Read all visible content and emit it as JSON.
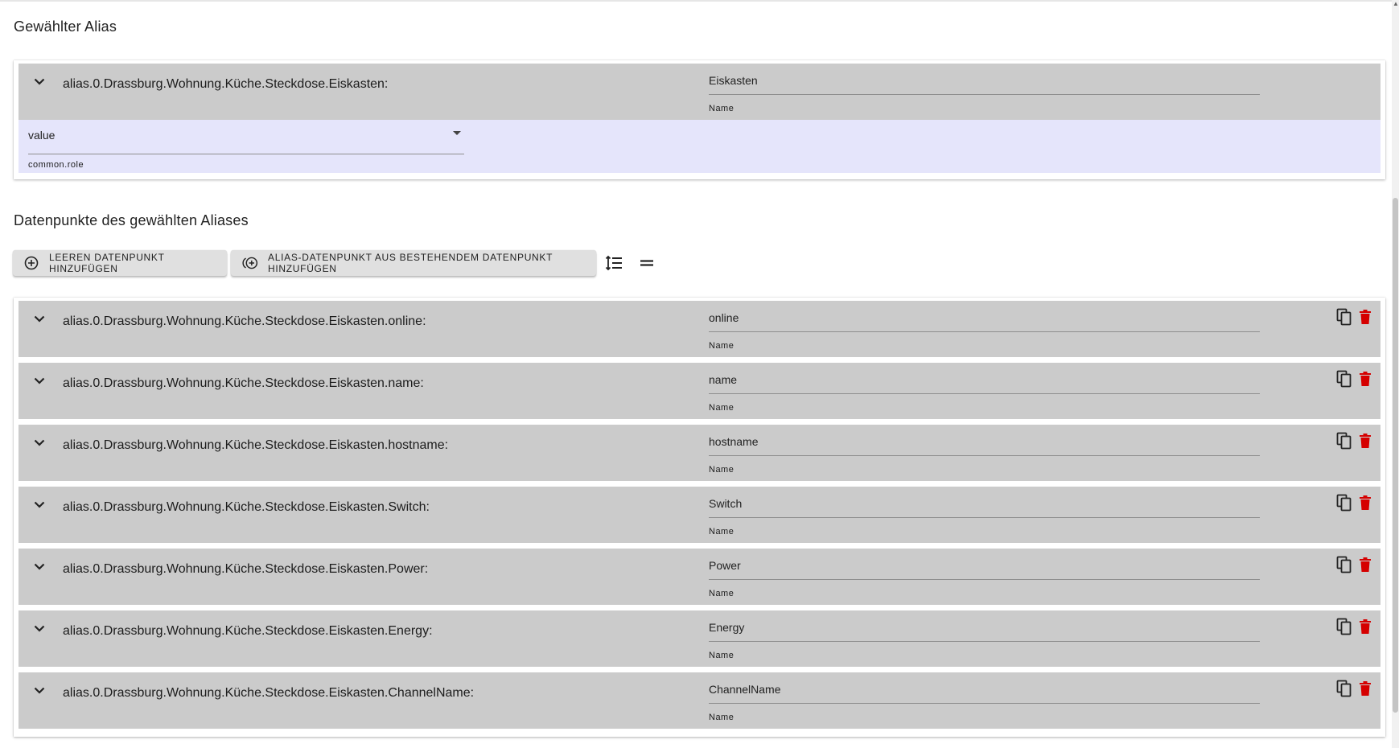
{
  "header": {
    "selected_alias_title": "Gewählter Alias",
    "datapoints_title": "Datenpunkte des gewählten Aliases"
  },
  "alias": {
    "id": "alias.0.Drassburg.Wohnung.Küche.Steckdose.Eiskasten:",
    "name_value": "Eiskasten",
    "name_label": "Name",
    "role_value": "value",
    "role_label": "common.role"
  },
  "toolbar": {
    "add_empty_label": "LEEREN DATENPUNKT HINZUFÜGEN",
    "add_from_existing_label": "ALIAS-DATENPUNKT AUS BESTEHENDEM DATENPUNKT HINZUFÜGEN"
  },
  "datapoints": [
    {
      "id": "alias.0.Drassburg.Wohnung.Küche.Steckdose.Eiskasten.online:",
      "name_value": "online",
      "name_label": "Name"
    },
    {
      "id": "alias.0.Drassburg.Wohnung.Küche.Steckdose.Eiskasten.name:",
      "name_value": "name",
      "name_label": "Name"
    },
    {
      "id": "alias.0.Drassburg.Wohnung.Küche.Steckdose.Eiskasten.hostname:",
      "name_value": "hostname",
      "name_label": "Name"
    },
    {
      "id": "alias.0.Drassburg.Wohnung.Küche.Steckdose.Eiskasten.Switch:",
      "name_value": "Switch",
      "name_label": "Name"
    },
    {
      "id": "alias.0.Drassburg.Wohnung.Küche.Steckdose.Eiskasten.Power:",
      "name_value": "Power",
      "name_label": "Name"
    },
    {
      "id": "alias.0.Drassburg.Wohnung.Küche.Steckdose.Eiskasten.Energy:",
      "name_value": "Energy",
      "name_label": "Name"
    },
    {
      "id": "alias.0.Drassburg.Wohnung.Küche.Steckdose.Eiskasten.ChannelName:",
      "name_value": "ChannelName",
      "name_label": "Name"
    }
  ],
  "colors": {
    "row_bg": "#cbcbcb",
    "role_bg": "#e5e5fb",
    "delete_red": "#d50000"
  }
}
